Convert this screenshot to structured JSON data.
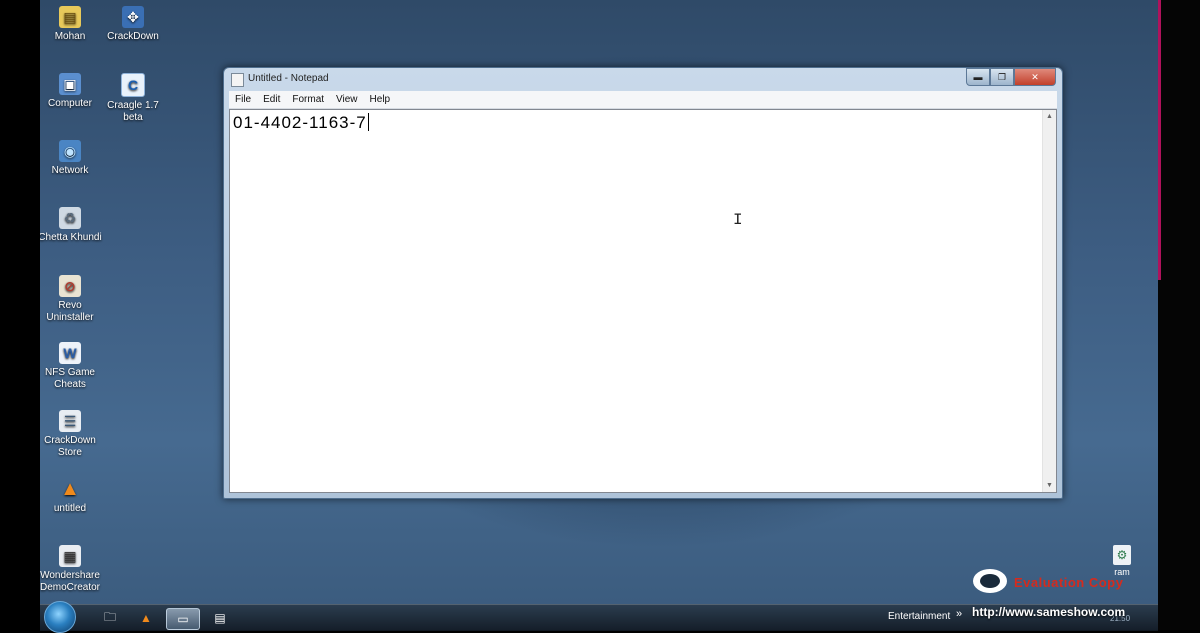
{
  "desktop": {
    "icons": [
      {
        "label": "Mohan",
        "icon": "user-folder-icon"
      },
      {
        "label": "CrackDown",
        "icon": "crackdown-app-icon"
      },
      {
        "label": "Computer",
        "icon": "computer-icon"
      },
      {
        "label": "Craagle 1.7 beta",
        "icon": "craagle-app-icon"
      },
      {
        "label": "Network",
        "icon": "network-icon"
      },
      {
        "label": "Chetta Khundi",
        "icon": "recycle-bin-icon"
      },
      {
        "label": "Revo Uninstaller",
        "icon": "revo-uninstaller-icon"
      },
      {
        "label": "NFS Game Cheats",
        "icon": "word-document-icon"
      },
      {
        "label": "CrackDown Store",
        "icon": "crackdown-store-icon"
      },
      {
        "label": "untitled",
        "icon": "vlc-icon"
      },
      {
        "label": "Wondershare DemoCreator",
        "icon": "democreator-icon"
      },
      {
        "label": "ram",
        "icon": "ram-file-icon"
      }
    ]
  },
  "notepad": {
    "title": "Untitled - Notepad",
    "menu": [
      "File",
      "Edit",
      "Format",
      "View",
      "Help"
    ],
    "content": "01-4402-1163-7",
    "close_glyph": "✕",
    "min_glyph": "▬",
    "max_glyph": "❐"
  },
  "taskbar": {
    "tray_label": "Entertainment",
    "tray_arrow": "»",
    "clock": "21:50"
  },
  "watermark": {
    "title": "Evaluation Copy",
    "url": "http://www.sameshow.com"
  }
}
